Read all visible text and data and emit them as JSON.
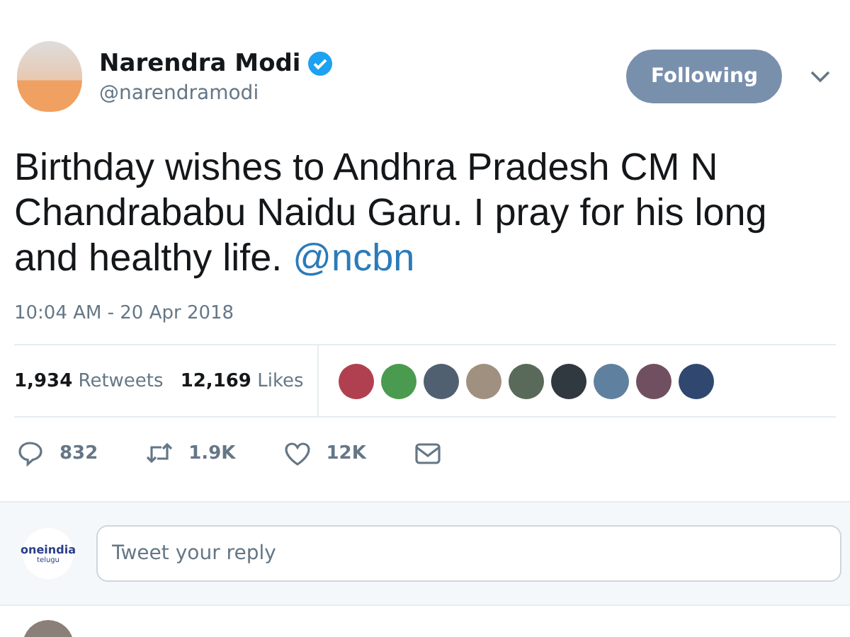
{
  "tweet": {
    "author": {
      "name": "Narendra Modi",
      "verified": true,
      "handle": "@narendramodi"
    },
    "follow_button": {
      "label": "Following",
      "selected": true
    },
    "text": "Birthday wishes to Andhra Pradesh CM N Chandrababu Naidu Garu. I pray for his long and healthy life.",
    "mention": "@ncbn",
    "timestamp": "10:04 AM - 20 Apr 2018",
    "stats": [
      {
        "count": "1,934",
        "label": "Retweets"
      },
      {
        "count": "12,169",
        "label": "Likes"
      }
    ],
    "actions": [
      {
        "kind": "reply",
        "count": "832"
      },
      {
        "kind": "retweet",
        "count": "1.9K"
      },
      {
        "kind": "like",
        "count": "12K"
      },
      {
        "kind": "message"
      }
    ]
  },
  "reply_box": {
    "logo": {
      "name": "oneindia",
      "sub": "telugu"
    },
    "placeholder": "Tweet your reply"
  }
}
